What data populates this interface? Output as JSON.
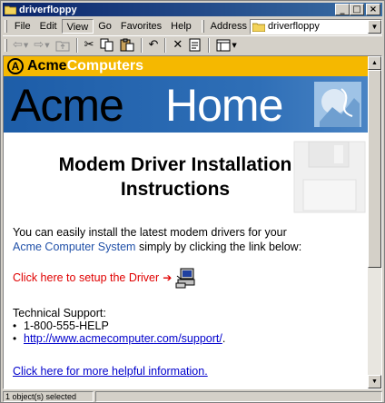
{
  "window": {
    "title": "driverfloppy",
    "controls": {
      "minimize": "_",
      "maximize": "□",
      "close": "×"
    }
  },
  "menu": {
    "items": [
      "File",
      "Edit",
      "View",
      "Go",
      "Favorites",
      "Help"
    ],
    "address_label": "Address",
    "address_value": "driverfloppy"
  },
  "toolbar": {
    "icons": [
      "back-icon",
      "forward-icon",
      "up-icon",
      "cut-icon",
      "copy-icon",
      "paste-icon",
      "undo-icon",
      "delete-icon",
      "properties-icon",
      "views-icon"
    ]
  },
  "page": {
    "banner": {
      "acme": "Acme",
      "computers": "Computers",
      "badge": "A",
      "home_acme": "Acme",
      "home_home": "Home"
    },
    "title_line1": "Modem Driver Installation",
    "title_line2": "Instructions",
    "intro_1": "You can easily install the latest modem drivers for your",
    "intro_highlight": "Acme Computer System",
    "intro_2": " simply by clicking the link below:",
    "setup_link": "Click here to setup the Driver",
    "tech_heading": "Technical Support:",
    "phone": "1-800-555-HELP",
    "support_url": "http://www.acmecomputer.com/support/",
    "support_url_suffix": ".",
    "more_link": "Click here for more helpful information."
  },
  "status": {
    "objects": "1 object(s) selected"
  },
  "colors": {
    "accent_yellow": "#f5b800",
    "banner_blue": "#2f6fb7",
    "setup_red": "#e00000",
    "link_blue": "#0000cc",
    "title_navy": "#0a246a"
  }
}
